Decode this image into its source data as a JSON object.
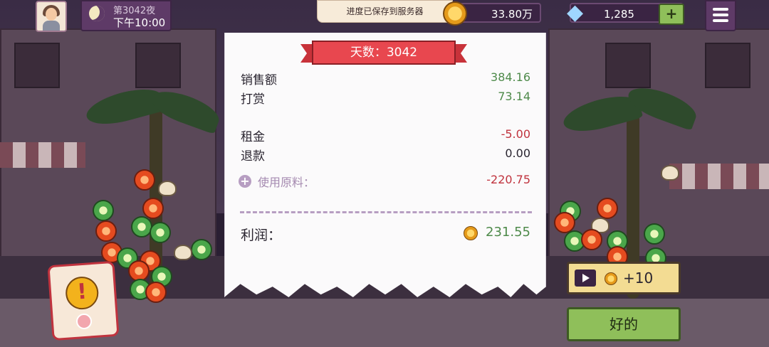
{
  "hud": {
    "night_label": "第3042夜",
    "time_label": "下午10:00",
    "toast": "进度已保存到服务器",
    "coins": "33.80万",
    "gems": "1,285",
    "add_label": "+"
  },
  "receipt": {
    "ribbon": "天数：3042",
    "sales_label": "销售额",
    "sales_value": "384.16",
    "tips_label": "打赏",
    "tips_value": "73.14",
    "rent_label": "租金",
    "rent_value": "-5.00",
    "refund_label": "退款",
    "refund_value": "0.00",
    "ingredients_label": "使用原料：",
    "ingredients_value": "-220.75",
    "profit_label": "利润：",
    "profit_value": "231.55",
    "expand_label": "+"
  },
  "actions": {
    "ad_reward": "+10",
    "ok": "好的"
  },
  "alert": {
    "mark": "!"
  },
  "colors": {
    "positive": "#4e8a4a",
    "negative": "#c0333e",
    "ok_button": "#8fbf5a",
    "ribbon": "#e8474f"
  }
}
